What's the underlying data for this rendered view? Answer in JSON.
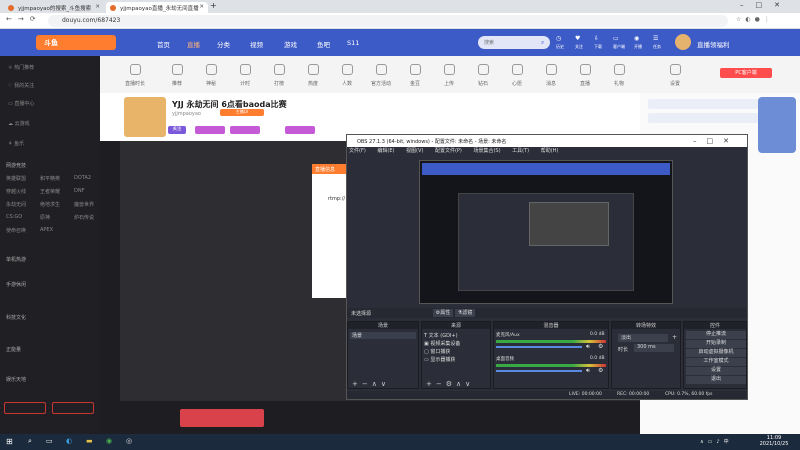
{
  "browser": {
    "tabs": [
      {
        "title": "yjjmpaoyao的搜索_斗鱼搜索",
        "active": false
      },
      {
        "title": "yjjmpaoyao直播_永劫无间直播",
        "active": true
      }
    ],
    "url": "douyu.com/687423"
  },
  "header": {
    "logo": "斗鱼",
    "nav": [
      "首页",
      "直播",
      "分类",
      "视频",
      "游戏",
      "鱼吧",
      "S11"
    ],
    "search_placeholder": "搜索",
    "tools": [
      "历史",
      "关注",
      "下载",
      "客户端",
      "开播",
      "任务"
    ],
    "stream_label": "直播领福利"
  },
  "sidebar": {
    "items": [
      "热门推荐",
      "我的关注",
      "直播中心",
      "云游戏",
      "鱼乐",
      "网游竞技",
      "单机热游",
      "手游休闲",
      "科技文化",
      "正能量",
      "娱乐天地"
    ],
    "tags": [
      "英雄联盟",
      "和平精英",
      "DOTA2",
      "穿越火线",
      "王者荣耀",
      "DNF",
      "永劫无间",
      "绝地求生",
      "魔兽世界",
      "CS:GO",
      "原神",
      "炉石传说",
      "使命召唤",
      "APEX"
    ]
  },
  "categories": [
    "直播时长",
    "推荐",
    "神秘",
    "计时",
    "打榜",
    "热度",
    "人数",
    "官方活动",
    "金豆",
    "上传",
    "钻石",
    "心愿",
    "消息",
    "直播",
    "礼物",
    "设置"
  ],
  "room": {
    "title": "YJJ 永劫无间 6点看baoda比赛",
    "streamer": "yjjmpaoyao",
    "follow": "关注",
    "level_badge": "主播LV",
    "pc_tag": "PC客户端"
  },
  "obs": {
    "title": "OBS 27.1.3 (64-bit, windows) - 配置文件: 未命名 - 场景: 未命名",
    "menu": [
      "文件(F)",
      "编辑(E)",
      "视图(V)",
      "配置文件(P)",
      "场景集合(S)",
      "工具(T)",
      "帮助(H)"
    ],
    "no_source": "未选择源",
    "props": "属性",
    "filters": "滤镜",
    "docks": {
      "scenes": "场景",
      "sources": "来源",
      "mixer": "混音器",
      "transitions": "转场特效",
      "controls": "控件"
    },
    "scene_items": [
      "场景"
    ],
    "source_items": [
      "文本 (GDI+)",
      "视频采集设备",
      "窗口捕获",
      "显示器捕获"
    ],
    "mixer_channels": [
      {
        "name": "麦克风/Aux",
        "db": "0.0 dB"
      },
      {
        "name": "桌面音频",
        "db": "0.0 dB"
      }
    ],
    "transition": "淡出",
    "duration_label": "时长",
    "duration": "300 ms",
    "control_buttons": [
      "停止推流",
      "开始录制",
      "启动虚拟摄像机",
      "工作室模式",
      "设置",
      "退出"
    ],
    "status": [
      "LIVE: 00:00:00",
      "REC: 00:00:00",
      "CPU: 0.7%, 60.00 fps"
    ]
  },
  "page_overlay": {
    "panel_title": "直播信息",
    "panel_text": "rtmp://"
  },
  "taskbar": {
    "time": "11:09",
    "date": "2021/10/25"
  },
  "colors": {
    "brand_blue": "#3d5bc7",
    "brand_orange": "#ff7d2e",
    "obs_bg": "#2b2e38"
  }
}
